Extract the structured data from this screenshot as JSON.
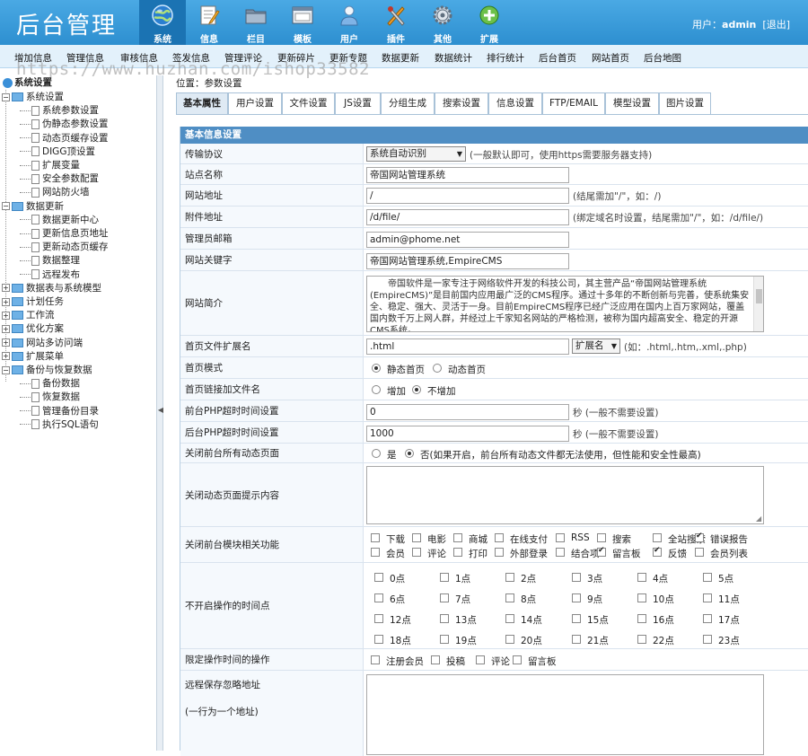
{
  "header": {
    "logo": "后台管理",
    "nav": [
      {
        "label": "系统",
        "icon": "globe-icon",
        "active": true
      },
      {
        "label": "信息",
        "icon": "notepad-icon",
        "active": false
      },
      {
        "label": "栏目",
        "icon": "folder-icon",
        "active": false
      },
      {
        "label": "模板",
        "icon": "window-icon",
        "active": false
      },
      {
        "label": "用户",
        "icon": "user-icon",
        "active": false
      },
      {
        "label": "插件",
        "icon": "tools-icon",
        "active": false
      },
      {
        "label": "其他",
        "icon": "gear-icon",
        "active": false
      },
      {
        "label": "扩展",
        "icon": "plus-icon",
        "active": false
      }
    ],
    "user_prefix": "用户：",
    "username": "admin",
    "logout": "[退出]"
  },
  "submenu": [
    "增加信息",
    "管理信息",
    "审核信息",
    "签发信息",
    "管理评论",
    "更新碎片",
    "更新专题",
    "数据更新",
    "数据统计",
    "排行统计",
    "后台首页",
    "网站首页",
    "后台地图"
  ],
  "watermark": "https://www.huzhan.com/ishop33582",
  "sidebar": {
    "root": "系统设置",
    "groups": [
      {
        "label": "系统设置",
        "expanded": true,
        "items": [
          "系统参数设置",
          "伪静态参数设置",
          "动态页缓存设置",
          "DIGG顶设置",
          "扩展变量",
          "安全参数配置",
          "网站防火墙"
        ]
      },
      {
        "label": "数据更新",
        "expanded": true,
        "items": [
          "数据更新中心",
          "更新信息页地址",
          "更新动态页缓存",
          "数据整理",
          "远程发布"
        ]
      },
      {
        "label": "数据表与系统模型",
        "expanded": false,
        "items": []
      },
      {
        "label": "计划任务",
        "expanded": false,
        "items": []
      },
      {
        "label": "工作流",
        "expanded": false,
        "items": []
      },
      {
        "label": "优化方案",
        "expanded": false,
        "items": []
      },
      {
        "label": "网站多访问端",
        "expanded": false,
        "items": []
      },
      {
        "label": "扩展菜单",
        "expanded": false,
        "items": []
      },
      {
        "label": "备份与恢复数据",
        "expanded": true,
        "items": [
          "备份数据",
          "恢复数据",
          "管理备份目录",
          "执行SQL语句"
        ]
      }
    ]
  },
  "breadcrumb": {
    "prefix": "位置：",
    "current": "参数设置"
  },
  "tabs": [
    "基本属性",
    "用户设置",
    "文件设置",
    "JS设置",
    "分组生成",
    "搜索设置",
    "信息设置",
    "FTP/EMAIL",
    "模型设置",
    "图片设置"
  ],
  "form": {
    "section_title": "基本信息设置",
    "protocol": {
      "label": "传输协议",
      "value": "系统自动识别",
      "hint": "(一般默认即可，使用https需要服务器支持)"
    },
    "site_name": {
      "label": "站点名称",
      "value": "帝国网站管理系统"
    },
    "site_url": {
      "label": "网站地址",
      "value": "/",
      "hint": "(结尾需加\"/\"，如：/)"
    },
    "attach_url": {
      "label": "附件地址",
      "value": "/d/file/",
      "hint": "(绑定域名时设置，结尾需加\"/\"，如：/d/file/)"
    },
    "email": {
      "label": "管理员邮箱",
      "value": "admin@phome.net"
    },
    "keywords": {
      "label": "网站关键字",
      "value": "帝国网站管理系统,EmpireCMS"
    },
    "intro": {
      "label": "网站简介",
      "value": "帝国软件是一家专注于网络软件开发的科技公司，其主营产品“帝国网站管理系统(EmpireCMS)”是目前国内应用最广泛的CMS程序。通过十多年的不断创新与完善，使系统集安全、稳定、强大、灵活于一身。目前EmpireCMS程序已经广泛应用在国内上百万家网站，覆盖国内数千万上网人群，并经过上千家知名网站的严格检测，被称为国内超高安全、稳定的开源CMS系统。"
    },
    "ext": {
      "label": "首页文件扩展名",
      "value": ".html",
      "select": "扩展名",
      "hint": "(如：.html,.htm,.xml,.php)"
    },
    "home_mode": {
      "label": "首页模式",
      "options": [
        "静态首页",
        "动态首页"
      ],
      "selected": 0
    },
    "home_link": {
      "label": "首页链接加文件名",
      "options": [
        "增加",
        "不增加"
      ],
      "selected": 1
    },
    "front_timeout": {
      "label": "前台PHP超时时间设置",
      "value": "0",
      "hint": "秒 (一般不需要设置)"
    },
    "back_timeout": {
      "label": "后台PHP超时时间设置",
      "value": "1000",
      "hint": "秒 (一般不需要设置)"
    },
    "close_dynamic": {
      "label": "关闭前台所有动态页面",
      "options": [
        "是",
        "否(如果开启，前台所有动态文件都无法使用，但性能和安全性最高)"
      ],
      "selected": 1
    },
    "close_tip": {
      "label": "关闭动态页面提示内容",
      "value": ""
    },
    "modules": {
      "label": "关闭前台模块相关功能",
      "items": [
        {
          "text": "下载",
          "checked": false
        },
        {
          "text": "电影",
          "checked": false
        },
        {
          "text": "商城",
          "checked": false
        },
        {
          "text": "在线支付",
          "checked": false
        },
        {
          "text": "RSS",
          "checked": false
        },
        {
          "text": "搜索",
          "checked": false
        },
        {
          "text": "全站搜索",
          "checked": false
        },
        {
          "text": "错误报告",
          "checked": true
        },
        {
          "text": "会员",
          "checked": false
        },
        {
          "text": "评论",
          "checked": false
        },
        {
          "text": "打印",
          "checked": false
        },
        {
          "text": "外部登录",
          "checked": false
        },
        {
          "text": "结合项",
          "checked": false
        },
        {
          "text": "留言板",
          "checked": true
        },
        {
          "text": "反馈",
          "checked": true
        },
        {
          "text": "会员列表",
          "checked": false
        }
      ]
    },
    "hours": {
      "label": "不开启操作的时间点",
      "items": [
        "0点",
        "1点",
        "2点",
        "3点",
        "4点",
        "5点",
        "6点",
        "7点",
        "8点",
        "9点",
        "10点",
        "11点",
        "12点",
        "13点",
        "14点",
        "15点",
        "16点",
        "17点",
        "18点",
        "19点",
        "20点",
        "21点",
        "22点",
        "23点"
      ]
    },
    "limit_ops": {
      "label": "限定操作时间的操作",
      "items": [
        "注册会员",
        "投稿",
        "评论",
        "留言板"
      ]
    },
    "remote": {
      "label": "远程保存忽略地址",
      "sub": "(一行为一个地址)",
      "value": ""
    }
  }
}
